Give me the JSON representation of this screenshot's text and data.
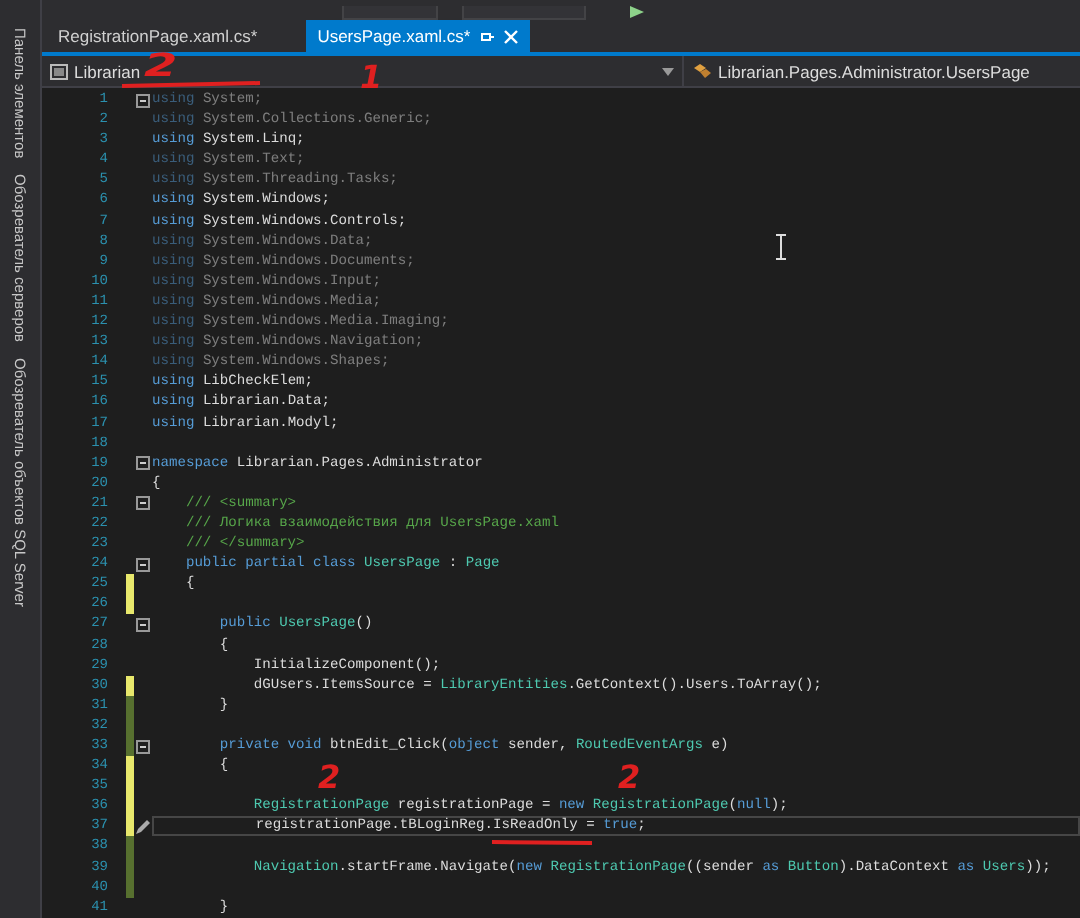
{
  "sidebar": {
    "items": [
      {
        "label": "Панель элементов"
      },
      {
        "label": "Обозреватель серверов"
      },
      {
        "label": "Обозреватель объектов SQL Server"
      }
    ]
  },
  "tabs": [
    {
      "label": "RegistrationPage.xaml.cs*",
      "selected": false
    },
    {
      "label": "UsersPage.xaml.cs*",
      "selected": true
    }
  ],
  "navigation_bar": {
    "project": "Librarian",
    "type": "Librarian.Pages.Administrator.UsersPage"
  },
  "editor": {
    "lines": [
      {
        "number": "1",
        "dimmed": true,
        "fold": true,
        "tokens": [
          {
            "kind": "keyword",
            "text": "using"
          },
          {
            "kind": "plain",
            "text": " System;"
          }
        ]
      },
      {
        "number": "2",
        "dimmed": true,
        "tokens": [
          {
            "kind": "keyword",
            "text": "using"
          },
          {
            "kind": "plain",
            "text": " System.Collections.Generic;"
          }
        ]
      },
      {
        "number": "3",
        "tokens": [
          {
            "kind": "keyword",
            "text": "using"
          },
          {
            "kind": "plain",
            "text": " System.Linq;"
          }
        ]
      },
      {
        "number": "4",
        "dimmed": true,
        "tokens": [
          {
            "kind": "keyword",
            "text": "using"
          },
          {
            "kind": "plain",
            "text": " System.Text;"
          }
        ]
      },
      {
        "number": "5",
        "dimmed": true,
        "tokens": [
          {
            "kind": "keyword",
            "text": "using"
          },
          {
            "kind": "plain",
            "text": " System.Threading.Tasks;"
          }
        ]
      },
      {
        "number": "6",
        "tokens": [
          {
            "kind": "keyword",
            "text": "using"
          },
          {
            "kind": "plain",
            "text": " System.Windows;"
          }
        ]
      },
      {
        "number": "7",
        "tokens": [
          {
            "kind": "keyword",
            "text": "using"
          },
          {
            "kind": "plain",
            "text": " System.Windows.Controls;"
          }
        ]
      },
      {
        "number": "8",
        "dimmed": true,
        "tokens": [
          {
            "kind": "keyword",
            "text": "using"
          },
          {
            "kind": "plain",
            "text": " System.Windows.Data;"
          }
        ]
      },
      {
        "number": "9",
        "dimmed": true,
        "tokens": [
          {
            "kind": "keyword",
            "text": "using"
          },
          {
            "kind": "plain",
            "text": " System.Windows.Documents;"
          }
        ]
      },
      {
        "number": "10",
        "dimmed": true,
        "tokens": [
          {
            "kind": "keyword",
            "text": "using"
          },
          {
            "kind": "plain",
            "text": " System.Windows.Input;"
          }
        ]
      },
      {
        "number": "11",
        "dimmed": true,
        "tokens": [
          {
            "kind": "keyword",
            "text": "using"
          },
          {
            "kind": "plain",
            "text": " System.Windows.Media;"
          }
        ]
      },
      {
        "number": "12",
        "dimmed": true,
        "tokens": [
          {
            "kind": "keyword",
            "text": "using"
          },
          {
            "kind": "plain",
            "text": " System.Windows.Media.Imaging;"
          }
        ]
      },
      {
        "number": "13",
        "dimmed": true,
        "tokens": [
          {
            "kind": "keyword",
            "text": "using"
          },
          {
            "kind": "plain",
            "text": " System.Windows.Navigation;"
          }
        ]
      },
      {
        "number": "14",
        "dimmed": true,
        "tokens": [
          {
            "kind": "keyword",
            "text": "using"
          },
          {
            "kind": "plain",
            "text": " System.Windows.Shapes;"
          }
        ]
      },
      {
        "number": "15",
        "tokens": [
          {
            "kind": "keyword",
            "text": "using"
          },
          {
            "kind": "plain",
            "text": " LibCheckElem;"
          }
        ]
      },
      {
        "number": "16",
        "tokens": [
          {
            "kind": "keyword",
            "text": "using"
          },
          {
            "kind": "plain",
            "text": " Librarian.Data;"
          }
        ]
      },
      {
        "number": "17",
        "tokens": [
          {
            "kind": "keyword",
            "text": "using"
          },
          {
            "kind": "plain",
            "text": " Librarian.Modyl;"
          }
        ]
      },
      {
        "number": "18"
      },
      {
        "number": "19",
        "fold": true,
        "tokens": [
          {
            "kind": "keyword",
            "text": "namespace"
          },
          {
            "kind": "plain",
            "text": " Librarian.Pages.Administrator"
          }
        ]
      },
      {
        "number": "20",
        "tokens": [
          {
            "kind": "plain",
            "text": "{"
          }
        ]
      },
      {
        "number": "21",
        "fold": true,
        "tokens": [
          {
            "kind": "comment",
            "text": "    /// <summary>"
          }
        ]
      },
      {
        "number": "22",
        "tokens": [
          {
            "kind": "comment",
            "text": "    /// Логика взаимодействия для UsersPage.xaml"
          }
        ]
      },
      {
        "number": "23",
        "tokens": [
          {
            "kind": "comment",
            "text": "    /// </summary>"
          }
        ]
      },
      {
        "number": "24",
        "fold": true,
        "tokens": [
          {
            "kind": "keyword",
            "text": "    public partial class "
          },
          {
            "kind": "type",
            "text": "UsersPage"
          },
          {
            "kind": "plain",
            "text": " : "
          },
          {
            "kind": "type",
            "text": "Page"
          }
        ]
      },
      {
        "number": "25",
        "changed": true,
        "saved": false,
        "tokens": [
          {
            "kind": "plain",
            "text": "    {"
          }
        ]
      },
      {
        "number": "26",
        "changed": true,
        "saved": false
      },
      {
        "number": "27",
        "fold": true,
        "tokens": [
          {
            "kind": "keyword",
            "text": "        public "
          },
          {
            "kind": "type",
            "text": "UsersPage"
          },
          {
            "kind": "plain",
            "text": "()"
          }
        ]
      },
      {
        "number": "28",
        "tokens": [
          {
            "kind": "plain",
            "text": "        {"
          }
        ]
      },
      {
        "number": "29",
        "tokens": [
          {
            "kind": "plain",
            "text": "            InitializeComponent();"
          }
        ]
      },
      {
        "number": "30",
        "changed": true,
        "saved": false,
        "tokens": [
          {
            "kind": "plain",
            "text": "            dGUsers.ItemsSource = "
          },
          {
            "kind": "type",
            "text": "LibraryEntities"
          },
          {
            "kind": "plain",
            "text": ".GetContext().Users.ToArray();"
          }
        ]
      },
      {
        "number": "31",
        "changed": true,
        "saved": true,
        "tokens": [
          {
            "kind": "plain",
            "text": "        }"
          }
        ]
      },
      {
        "number": "32",
        "changed": true,
        "saved": true
      },
      {
        "number": "33",
        "changed": true,
        "saved": true,
        "fold": true,
        "tokens": [
          {
            "kind": "keyword",
            "text": "        private void"
          },
          {
            "kind": "plain",
            "text": " btnEdit_Click("
          },
          {
            "kind": "keyword",
            "text": "object"
          },
          {
            "kind": "plain",
            "text": " sender, "
          },
          {
            "kind": "type",
            "text": "RoutedEventArgs"
          },
          {
            "kind": "plain",
            "text": " e)"
          }
        ]
      },
      {
        "number": "34",
        "changed": true,
        "saved": false,
        "tokens": [
          {
            "kind": "plain",
            "text": "        {"
          }
        ]
      },
      {
        "number": "35",
        "changed": true,
        "saved": false
      },
      {
        "number": "36",
        "changed": true,
        "saved": false,
        "tokens": [
          {
            "kind": "type",
            "text": "            RegistrationPage"
          },
          {
            "kind": "plain",
            "text": " registrationPage = "
          },
          {
            "kind": "keyword",
            "text": "new "
          },
          {
            "kind": "type",
            "text": "RegistrationPage"
          },
          {
            "kind": "plain",
            "text": "("
          },
          {
            "kind": "keyword",
            "text": "null"
          },
          {
            "kind": "plain",
            "text": ");"
          }
        ]
      },
      {
        "number": "37",
        "changed": true,
        "saved": false,
        "current": true,
        "tokens": [
          {
            "kind": "plain",
            "text": "            registrationPage.tBLoginReg.IsReadOnly = "
          },
          {
            "kind": "keyword",
            "text": "true"
          },
          {
            "kind": "plain",
            "text": ";"
          }
        ]
      },
      {
        "number": "38",
        "changed": true,
        "saved": true
      },
      {
        "number": "39",
        "changed": true,
        "saved": true,
        "tokens": [
          {
            "kind": "type",
            "text": "            Navigation"
          },
          {
            "kind": "plain",
            "text": ".startFrame.Navigate("
          },
          {
            "kind": "keyword",
            "text": "new "
          },
          {
            "kind": "type",
            "text": "RegistrationPage"
          },
          {
            "kind": "plain",
            "text": "((sender "
          },
          {
            "kind": "keyword",
            "text": "as "
          },
          {
            "kind": "type",
            "text": "Button"
          },
          {
            "kind": "plain",
            "text": ").DataContext "
          },
          {
            "kind": "keyword",
            "text": "as "
          },
          {
            "kind": "type",
            "text": "Users"
          },
          {
            "kind": "plain",
            "text": "));"
          }
        ]
      },
      {
        "number": "40",
        "changed": true,
        "saved": true
      },
      {
        "number": "41",
        "tokens": [
          {
            "kind": "plain",
            "text": "        }"
          }
        ]
      }
    ]
  },
  "annotations": [
    {
      "text": "2"
    },
    {
      "text": "1"
    },
    {
      "text": "2"
    },
    {
      "text": "2"
    }
  ]
}
